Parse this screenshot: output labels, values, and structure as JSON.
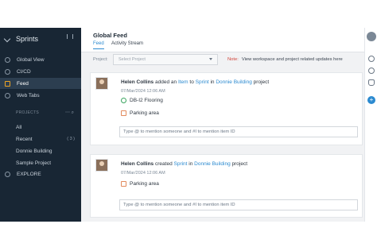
{
  "sidebar": {
    "title": "Sprints",
    "items": [
      {
        "label": "Global View"
      },
      {
        "label": "CI/CD"
      },
      {
        "label": "Feed"
      },
      {
        "label": "Web Tabs"
      }
    ],
    "projects_label": "PROJECTS",
    "projects_tools": "⋯  ⌕",
    "sub_items": [
      {
        "label": "All"
      },
      {
        "label": "Recent",
        "count": "( 3 )"
      },
      {
        "label": "Donnie Building"
      },
      {
        "label": "Sample Project"
      }
    ],
    "explore": "EXPLORE"
  },
  "header": {
    "title": "Global Feed",
    "tabs": [
      {
        "label": "Feed"
      },
      {
        "label": "Activity Stream"
      }
    ]
  },
  "filter": {
    "label": "Project:",
    "select_placeholder": "Select Project",
    "note_label": "Note:",
    "note_text": "View workspace and project related updates here"
  },
  "feed": [
    {
      "user": "Helen Collins",
      "t1": "added an",
      "l1": "Item",
      "t2": "to",
      "l2": "Sprint",
      "t3": "in",
      "l3": "Donnie Building",
      "t4": "project",
      "date": "07/Mar/2024 12:06 AM",
      "items": [
        {
          "label": "DB-I2 Flooring",
          "icon": "item-icon"
        },
        {
          "label": "Parking area",
          "icon": "sprint-icon"
        }
      ],
      "comment_placeholder": "Type @ to mention someone and #I to mention item ID"
    },
    {
      "user": "Helen Collins",
      "t1": "created",
      "l1": "Sprint",
      "t2": "in",
      "l2": "Donnie Building",
      "t3": "project",
      "date": "07/Mar/2024 12:06 AM",
      "items": [
        {
          "label": "Parking area",
          "icon": "sprint-icon"
        }
      ],
      "comment_placeholder": "Type @ to mention someone and #I to mention item ID"
    }
  ],
  "colors": {
    "sidebar_bg": "#182634",
    "accent": "#2b8ad0",
    "note_red": "#d2453b"
  }
}
